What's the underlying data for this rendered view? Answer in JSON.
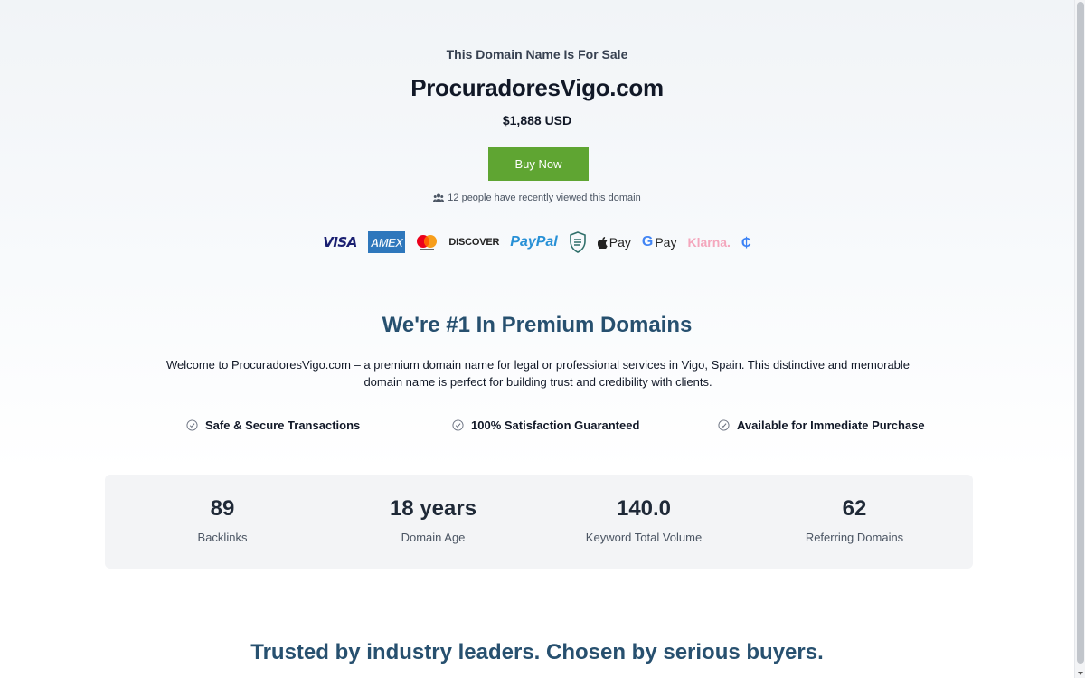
{
  "hero": {
    "sale_label": "This Domain Name Is For Sale",
    "domain": "ProcuradoresVigo.com",
    "price": "$1,888 USD",
    "buy_label": "Buy Now",
    "viewers_text": "12 people have recently viewed this domain",
    "buy_color": "#5fa532"
  },
  "payments": {
    "visa": "VISA",
    "amex": "AMEX",
    "discover": "DISCOVER",
    "paypal_a": "Pay",
    "paypal_b": "Pal",
    "applepay": "Pay",
    "gpay": "Pay",
    "gpay_g": "G",
    "klarna": "Klarna.",
    "coin": "₵"
  },
  "premium": {
    "title": "We're #1 In Premium Domains",
    "description": "Welcome to ProcuradoresVigo.com – a premium domain name for legal or professional services in Vigo, Spain. This distinctive and memorable domain name is perfect for building trust and credibility with clients."
  },
  "features": [
    {
      "label": "Safe & Secure Transactions"
    },
    {
      "label": "100% Satisfaction Guaranteed"
    },
    {
      "label": "Available for Immediate Purchase"
    }
  ],
  "stats": [
    {
      "value": "89",
      "label": "Backlinks"
    },
    {
      "value": "18 years",
      "label": "Domain Age"
    },
    {
      "value": "140.0",
      "label": "Keyword Total Volume"
    },
    {
      "value": "62",
      "label": "Referring Domains"
    }
  ],
  "trusted": {
    "title": "Trusted by industry leaders. Chosen by serious buyers."
  },
  "colors": {
    "heading": "#27506f",
    "stats_bg": "#f3f4f6"
  }
}
